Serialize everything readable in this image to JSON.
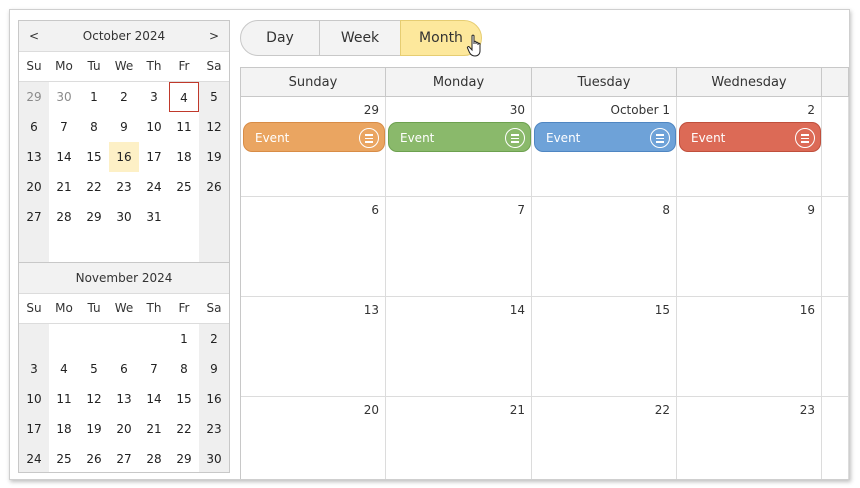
{
  "navigator": {
    "prev_label": "<",
    "next_label": ">",
    "weekday_labels": [
      "Su",
      "Mo",
      "Tu",
      "We",
      "Th",
      "Fr",
      "Sa"
    ],
    "months": [
      {
        "title": "October 2024",
        "weeks": [
          [
            {
              "d": "29",
              "o": true
            },
            {
              "d": "30",
              "o": true
            },
            {
              "d": "1"
            },
            {
              "d": "2"
            },
            {
              "d": "3"
            },
            {
              "d": "4",
              "today": true
            },
            {
              "d": "5"
            }
          ],
          [
            {
              "d": "6"
            },
            {
              "d": "7"
            },
            {
              "d": "8"
            },
            {
              "d": "9"
            },
            {
              "d": "10"
            },
            {
              "d": "11"
            },
            {
              "d": "12"
            }
          ],
          [
            {
              "d": "13"
            },
            {
              "d": "14"
            },
            {
              "d": "15"
            },
            {
              "d": "16",
              "selected": true
            },
            {
              "d": "17"
            },
            {
              "d": "18"
            },
            {
              "d": "19"
            }
          ],
          [
            {
              "d": "20"
            },
            {
              "d": "21"
            },
            {
              "d": "22"
            },
            {
              "d": "23"
            },
            {
              "d": "24"
            },
            {
              "d": "25"
            },
            {
              "d": "26"
            }
          ],
          [
            {
              "d": "27"
            },
            {
              "d": "28"
            },
            {
              "d": "29"
            },
            {
              "d": "30"
            },
            {
              "d": "31"
            },
            {
              "d": ""
            },
            {
              "d": ""
            }
          ],
          [
            {
              "d": ""
            },
            {
              "d": ""
            },
            {
              "d": ""
            },
            {
              "d": ""
            },
            {
              "d": ""
            },
            {
              "d": ""
            },
            {
              "d": ""
            }
          ]
        ]
      },
      {
        "title": "November 2024",
        "weeks": [
          [
            {
              "d": ""
            },
            {
              "d": ""
            },
            {
              "d": ""
            },
            {
              "d": ""
            },
            {
              "d": ""
            },
            {
              "d": "1"
            },
            {
              "d": "2"
            }
          ],
          [
            {
              "d": "3"
            },
            {
              "d": "4"
            },
            {
              "d": "5"
            },
            {
              "d": "6"
            },
            {
              "d": "7"
            },
            {
              "d": "8"
            },
            {
              "d": "9"
            }
          ],
          [
            {
              "d": "10"
            },
            {
              "d": "11"
            },
            {
              "d": "12"
            },
            {
              "d": "13"
            },
            {
              "d": "14"
            },
            {
              "d": "15"
            },
            {
              "d": "16"
            }
          ],
          [
            {
              "d": "17"
            },
            {
              "d": "18"
            },
            {
              "d": "19"
            },
            {
              "d": "20"
            },
            {
              "d": "21"
            },
            {
              "d": "22"
            },
            {
              "d": "23"
            }
          ],
          [
            {
              "d": "24"
            },
            {
              "d": "25"
            },
            {
              "d": "26"
            },
            {
              "d": "27"
            },
            {
              "d": "28"
            },
            {
              "d": "29"
            },
            {
              "d": "30"
            }
          ]
        ]
      }
    ]
  },
  "view_tabs": {
    "day_label": "Day",
    "week_label": "Week",
    "month_label": "Month",
    "active": "Month"
  },
  "calendar": {
    "column_headers": [
      "Sunday",
      "Monday",
      "Tuesday",
      "Wednesday",
      ""
    ],
    "weeks": [
      [
        "29",
        "30",
        "October 1",
        "2",
        ""
      ],
      [
        "6",
        "7",
        "8",
        "9",
        ""
      ],
      [
        "13",
        "14",
        "15",
        "16",
        ""
      ],
      [
        "20",
        "21",
        "22",
        "23",
        ""
      ]
    ],
    "events": [
      {
        "text": "Event",
        "color": "#eaa561",
        "border": "#d88c46",
        "icon": "menu-icon"
      },
      {
        "text": "Event",
        "color": "#8ab96b",
        "border": "#6da14f",
        "icon": "menu-icon"
      },
      {
        "text": "Event",
        "color": "#6ea2d8",
        "border": "#4f86c2",
        "icon": "menu-icon"
      },
      {
        "text": "Event",
        "color": "#dc6a56",
        "border": "#c04f3c",
        "icon": "menu-icon"
      }
    ]
  }
}
